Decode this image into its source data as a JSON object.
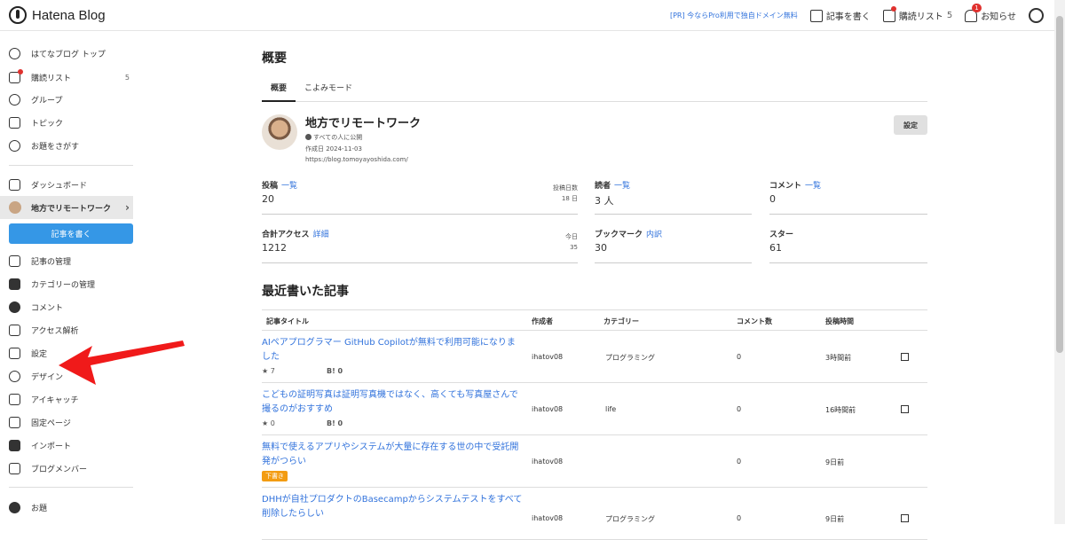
{
  "topbar": {
    "logo": "Hatena Blog",
    "pr": "[PR] 今ならPro利用で独自ドメイン無料",
    "write": "記事を書く",
    "reading_list": "購読リスト",
    "reading_count": "5",
    "notifications": "お知らせ",
    "notification_badge": "1"
  },
  "sidebar": {
    "top_items": [
      {
        "label": "はてなブログ トップ",
        "icon": "hatena-icon"
      },
      {
        "label": "購読リスト",
        "icon": "reading-list-icon",
        "count": "5"
      },
      {
        "label": "グループ",
        "icon": "group-icon"
      },
      {
        "label": "トピック",
        "icon": "topic-icon"
      },
      {
        "label": "お題をさがす",
        "icon": "theme-search-icon"
      }
    ],
    "dashboard": "ダッシュボード",
    "current_blog": "地方でリモートワーク",
    "write_button": "記事を書く",
    "blog_items": [
      {
        "label": "記事の管理",
        "icon": "edit-icon"
      },
      {
        "label": "カテゴリーの管理",
        "icon": "folder-icon"
      },
      {
        "label": "コメント",
        "icon": "comment-icon"
      },
      {
        "label": "アクセス解析",
        "icon": "chart-icon"
      },
      {
        "label": "設定",
        "icon": "wrench-icon"
      },
      {
        "label": "デザイン",
        "icon": "palette-icon"
      },
      {
        "label": "アイキャッチ",
        "icon": "eyecatch-icon"
      },
      {
        "label": "固定ページ",
        "icon": "page-icon"
      },
      {
        "label": "インポート",
        "icon": "truck-icon"
      },
      {
        "label": "ブログメンバー",
        "icon": "members-icon"
      }
    ],
    "bottom_item": "お題"
  },
  "main": {
    "title": "概要",
    "tabs": [
      "概要",
      "こよみモード"
    ],
    "blog": {
      "name": "地方でリモートワーク",
      "visibility": "すべての人に公開",
      "created": "作成日 2024-11-03",
      "url": "https://blog.tomoyayoshida.com/"
    },
    "settings_button": "設定",
    "stats": {
      "posts": {
        "label": "投稿",
        "link": "一覧",
        "value": "20",
        "sub_label": "投稿日数",
        "sub_value": "18 日"
      },
      "readers": {
        "label": "読者",
        "link": "一覧",
        "value": "3 人"
      },
      "comments": {
        "label": "コメント",
        "link": "一覧",
        "value": "0"
      },
      "access": {
        "label": "合計アクセス",
        "link": "詳細",
        "value": "1212",
        "sub_label": "今日",
        "sub_value": "35"
      },
      "bookmarks": {
        "label": "ブックマーク",
        "link": "内訳",
        "value": "30"
      },
      "stars": {
        "label": "スター",
        "value": "61"
      }
    },
    "recent_title": "最近書いた記事",
    "table_headers": [
      "記事タイトル",
      "作成者",
      "カテゴリー",
      "コメント数",
      "投稿時間"
    ],
    "rows": [
      {
        "title": "AIペアプログラマー GitHub Copilotが無料で利用可能になりました",
        "author": "ihatov08",
        "category": "プログラミング",
        "comments": "0",
        "time": "3時間前",
        "stars": "★ 7",
        "bookmarks": "B! 0"
      },
      {
        "title": "こどもの証明写真は証明写真機ではなく、高くても写真屋さんで撮るのがおすすめ",
        "author": "ihatov08",
        "category": "life",
        "comments": "0",
        "time": "16時間前",
        "stars": "★ 0",
        "bookmarks": "B! 0"
      },
      {
        "title": "無料で使えるアプリやシステムが大量に存在する世の中で受託開発がつらい",
        "author": "ihatov08",
        "category": "",
        "comments": "0",
        "time": "9日前",
        "draft": "下書き"
      },
      {
        "title": "DHHが自社プロダクトのBasecampからシステムテストをすべて削除したらしい",
        "author": "ihatov08",
        "category": "プログラミング",
        "comments": "0",
        "time": "9日前"
      }
    ]
  },
  "annotation": {
    "arrow_color": "#f01a1a"
  }
}
